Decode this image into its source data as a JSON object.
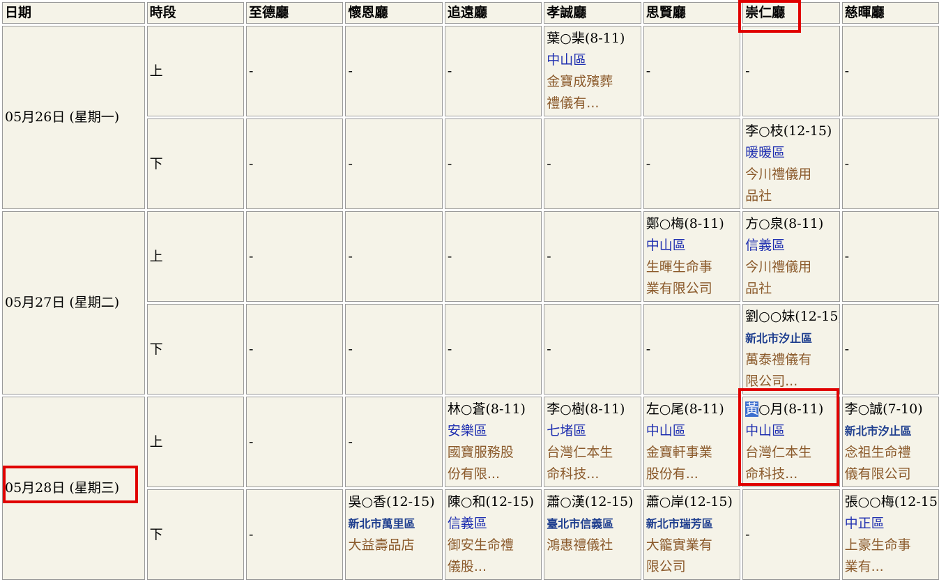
{
  "headers": [
    "日期",
    "時段",
    "至德廳",
    "懷恩廳",
    "追遠廳",
    "孝誠廳",
    "思賢廳",
    "崇仁廳",
    "慈暉廳"
  ],
  "days": [
    {
      "date": "05月26日 (星期一)",
      "slots": [
        {
          "period": "上",
          "cells": [
            {
              "dash": "-"
            },
            {
              "dash": "-"
            },
            {
              "dash": "-"
            },
            {
              "name": "葉○棐(8-11)",
              "district": "中山區",
              "org": [
                "金寶成殯葬",
                "禮儀有..."
              ]
            },
            {
              "dash": "-"
            },
            {
              "dash": "-"
            },
            {
              "dash": "-"
            }
          ]
        },
        {
          "period": "下",
          "cells": [
            {
              "dash": "-"
            },
            {
              "dash": "-"
            },
            {
              "dash": "-"
            },
            {
              "dash": "-"
            },
            {
              "dash": "-"
            },
            {
              "name": "李○枝(12-15)",
              "district": "暖暖區",
              "org": [
                "今川禮儀用",
                "品社"
              ]
            },
            {
              "dash": "-"
            }
          ]
        }
      ]
    },
    {
      "date": "05月27日 (星期二)",
      "slots": [
        {
          "period": "上",
          "cells": [
            {
              "dash": "-"
            },
            {
              "dash": "-"
            },
            {
              "dash": "-"
            },
            {
              "dash": "-"
            },
            {
              "name": "鄭○梅(8-11)",
              "district": "中山區",
              "org": [
                "生暉生命事",
                "業有限公司"
              ]
            },
            {
              "name": "方○泉(8-11)",
              "district": "信義區",
              "org": [
                "今川禮儀用",
                "品社"
              ]
            },
            {
              "dash": "-"
            }
          ]
        },
        {
          "period": "下",
          "cells": [
            {
              "dash": "-"
            },
            {
              "dash": "-"
            },
            {
              "dash": "-"
            },
            {
              "dash": "-"
            },
            {
              "dash": "-"
            },
            {
              "name": "劉○○妹(12-15)",
              "district": "新北市汐止區",
              "org": [
                "萬泰禮儀有",
                "限公司..."
              ]
            },
            {
              "dash": "-"
            }
          ]
        }
      ]
    },
    {
      "date": "05月28日 (星期三)",
      "slots": [
        {
          "period": "上",
          "cells": [
            {
              "dash": "-"
            },
            {
              "dash": "-"
            },
            {
              "name": "林○蒼(8-11)",
              "district": "安樂區",
              "org": [
                "國寶服務股",
                "份有限..."
              ]
            },
            {
              "name": "李○樹(8-11)",
              "district": "七堵區",
              "org": [
                "台灣仁本生",
                "命科技..."
              ]
            },
            {
              "name": "左○尾(8-11)",
              "district": "中山區",
              "org": [
                "金寶軒事業",
                "股份有..."
              ]
            },
            {
              "name_hl": "黃",
              "name_rest": "○月(8-11)",
              "district": "中山區",
              "org": [
                "台灣仁本生",
                "命科技..."
              ]
            },
            {
              "name": "李○誠(7-10)",
              "district": "新北市汐止區",
              "org": [
                "念祖生命禮",
                "儀有限公司"
              ]
            }
          ]
        },
        {
          "period": "下",
          "cells": [
            {
              "dash": "-"
            },
            {
              "name": "吳○香(12-15)",
              "district": "新北市萬里區",
              "org": [
                "大益壽品店"
              ]
            },
            {
              "name": "陳○和(12-15)",
              "district": "信義區",
              "org": [
                "御安生命禮",
                "儀股..."
              ]
            },
            {
              "name": "蕭○漢(12-15)",
              "district": "臺北市信義區",
              "org": [
                "鴻惠禮儀社"
              ]
            },
            {
              "name": "蕭○岸(12-15)",
              "district": "新北市瑞芳區",
              "org": [
                "大籠實業有",
                "限公司"
              ]
            },
            {
              "dash": "-"
            },
            {
              "name": "張○○梅(12-15)",
              "district": "中正區",
              "org": [
                "上豪生命事",
                "業有..."
              ]
            }
          ]
        }
      ]
    }
  ]
}
